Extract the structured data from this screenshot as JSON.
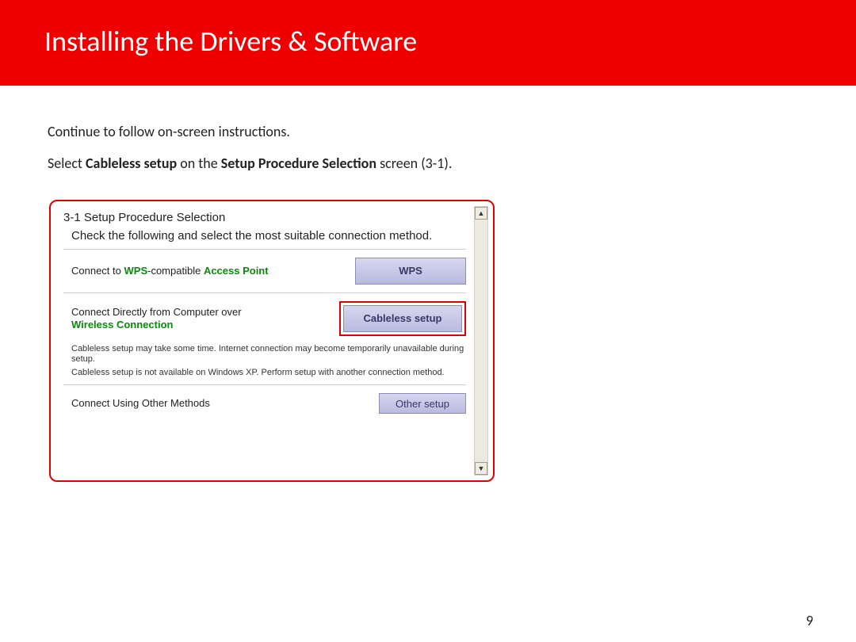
{
  "header": {
    "title": "Installing  the Drivers & Software"
  },
  "body": {
    "line1": "Continue to follow on-screen instructions.",
    "line2_pre": "Select ",
    "line2_b1": "Cableless setup",
    "line2_mid": " on the ",
    "line2_b2": "Setup Procedure Selection",
    "line2_post": " screen (3-1)."
  },
  "dialog": {
    "title": "3-1 Setup Procedure Selection",
    "subtitle": "Check the following and select the most suitable connection method.",
    "opt1": {
      "label_pre": "Connect to ",
      "label_g1": "WPS",
      "label_mid": "-compatible ",
      "label_g2": "Access Point",
      "button": "WPS"
    },
    "opt2": {
      "label_pre": "Connect Directly from Computer over ",
      "label_g": "Wireless Connection",
      "button": "Cableless setup"
    },
    "note1": "Cableless setup may take some time. Internet connection may become temporarily unavailable during setup.",
    "note2": "Cableless setup is not available on Windows XP. Perform setup with another connection method.",
    "opt3": {
      "label": "Connect Using Other Methods",
      "button": "Other setup"
    },
    "scroll_up": "▲",
    "scroll_down": "▼"
  },
  "page_number": "9"
}
